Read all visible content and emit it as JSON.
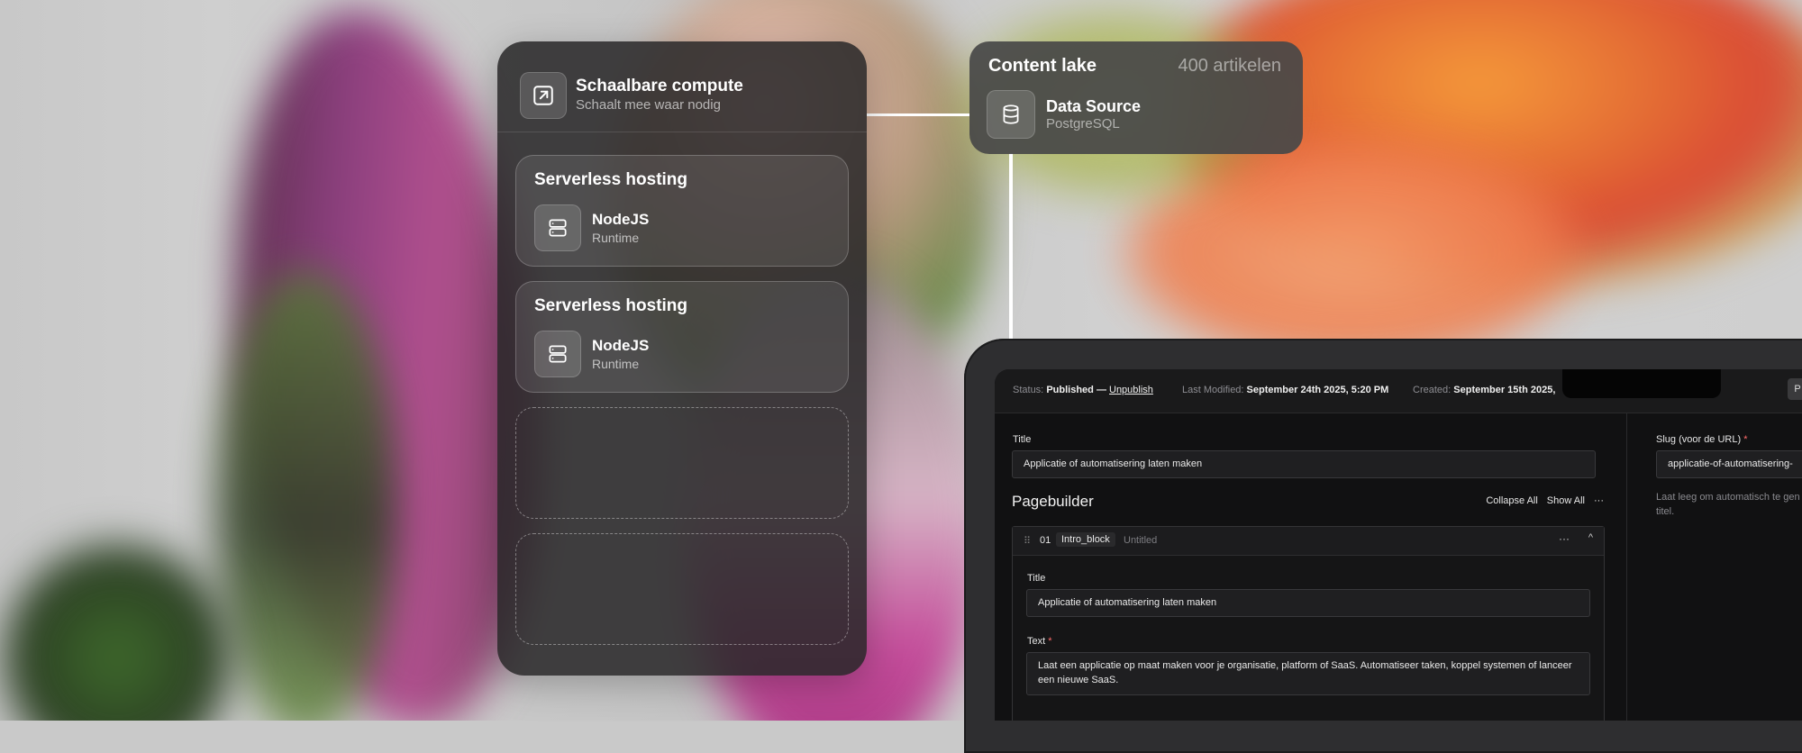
{
  "compute": {
    "title": "Schaalbare compute",
    "subtitle": "Schaalt mee waar nodig",
    "icon": "external-link-icon"
  },
  "hosting_cards": [
    {
      "title": "Serverless hosting",
      "runtime": "NodeJS",
      "runtime_sub": "Runtime",
      "icon": "server-icon"
    },
    {
      "title": "Serverless hosting",
      "runtime": "NodeJS",
      "runtime_sub": "Runtime",
      "icon": "server-icon"
    }
  ],
  "content_lake": {
    "title": "Content lake",
    "count": "400 artikelen",
    "source_title": "Data Source",
    "source_sub": "PostgreSQL",
    "icon": "database-icon"
  },
  "cms": {
    "status_label": "Status:",
    "status_value": "Published",
    "status_sep": "—",
    "unpublish": "Unpublish",
    "modified_label": "Last Modified:",
    "modified_value": "September 24th 2025, 5:20 PM",
    "created_label": "Created:",
    "created_value": "September 15th 2025,",
    "top_button": "P",
    "title_label": "Title",
    "title_value": "Applicatie of automatisering laten maken",
    "pagebuilder": "Pagebuilder",
    "collapse_all": "Collapse All",
    "show_all": "Show All",
    "more": "···",
    "block": {
      "drag": "⠿",
      "num": "01",
      "type": "Intro_block",
      "name": "Untitled",
      "more": "···",
      "chevron": "^",
      "title_label": "Title",
      "title_value": "Applicatie of automatisering laten maken",
      "text_label": "Text",
      "required": "*",
      "text_value": "Laat een applicatie op maat maken voor je organisatie, platform of SaaS. Automatiseer taken, koppel systemen of lanceer een nieuwe SaaS."
    },
    "slug_label": "Slug (voor de URL)",
    "slug_required": "*",
    "slug_value": "applicatie-of-automatisering-",
    "slug_hint": "Laat leeg om automatisch te gen titel."
  },
  "colors": {
    "panel_bg": "#282628",
    "cms_bg": "#111112",
    "required": "#ff6b6b"
  }
}
